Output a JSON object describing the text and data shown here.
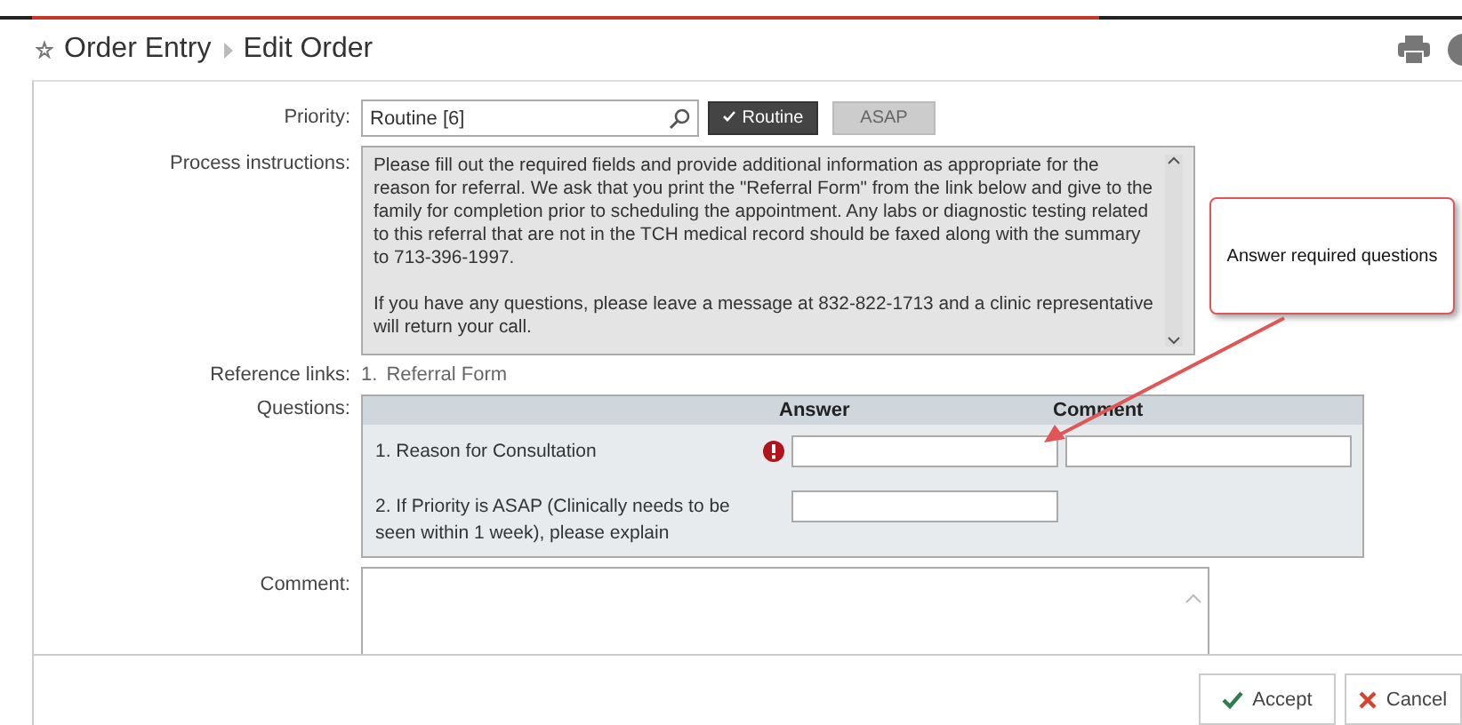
{
  "header": {
    "breadcrumbs": [
      "Order Entry",
      "Edit Order"
    ]
  },
  "priority": {
    "label": "Priority:",
    "value": "Routine [6]",
    "options": [
      {
        "label": "Routine",
        "selected": true
      },
      {
        "label": "ASAP",
        "selected": false
      }
    ]
  },
  "process_instructions": {
    "label": "Process instructions:",
    "paragraphs": [
      "Please fill out the required fields and provide additional information as appropriate for the reason for referral.  We ask that you print the \"Referral Form\" from the link below and give to the family for completion prior to scheduling the appointment.  Any labs or diagnostic testing related to this referral that are not in the TCH medical record should be faxed along with the summary to 713-396-1997.",
      "If you have any questions, please leave a message at 832-822-1713 and a clinic representative will return your call."
    ]
  },
  "reference_links": {
    "label": "Reference links:",
    "links": [
      {
        "number": "1.",
        "text": "Referral Form"
      }
    ]
  },
  "questions": {
    "label": "Questions:",
    "columns": [
      "Answer",
      "Comment"
    ],
    "rows": [
      {
        "text": "1. Reason for Consultation",
        "required": true,
        "kind": "answer_comment"
      },
      {
        "text": "2. If Priority is ASAP (Clinically needs to be seen within 1 week), please explain",
        "required": false,
        "kind": "answer_only"
      }
    ]
  },
  "comment": {
    "label": "Comment:"
  },
  "callout": {
    "text": "Answer required questions"
  },
  "buttons": [
    {
      "label": "Accept",
      "kind": "accept"
    },
    {
      "label": "Cancel",
      "kind": "cancel"
    }
  ]
}
